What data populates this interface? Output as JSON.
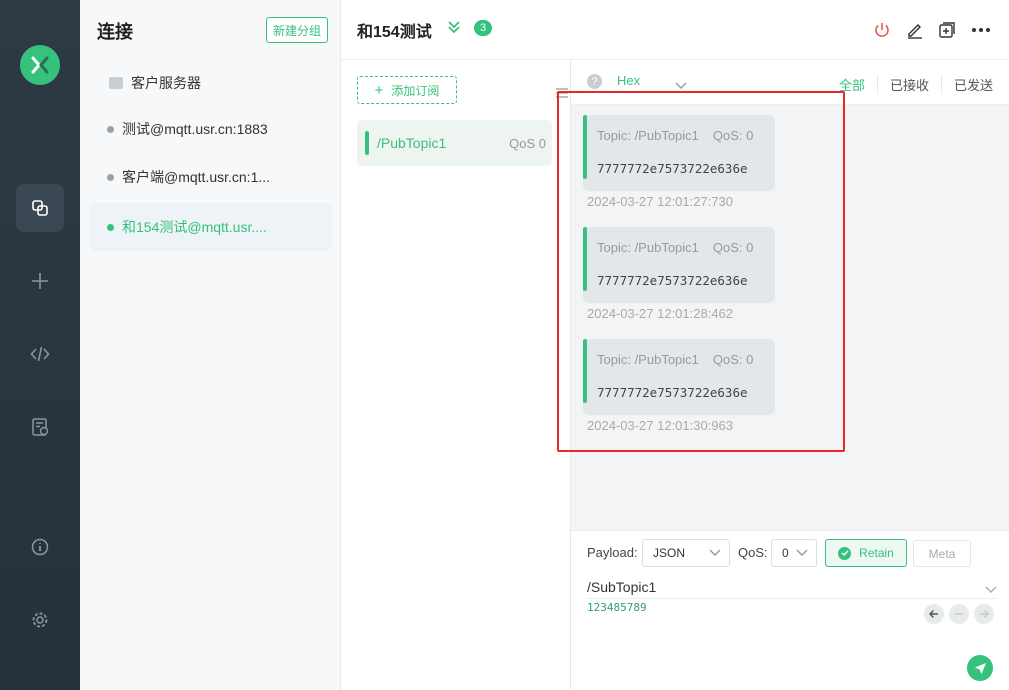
{
  "colors": {
    "accent": "#35c27d",
    "rail_bg": "#2e3a43",
    "highlight": "#e5292a"
  },
  "rail": {
    "logo": "mqttx-logo",
    "items": [
      {
        "icon": "connections-icon",
        "active": true
      },
      {
        "icon": "plus-icon",
        "active": false
      },
      {
        "icon": "code-icon",
        "active": false
      },
      {
        "icon": "log-icon",
        "active": false
      },
      {
        "icon": "info-icon",
        "active": false
      },
      {
        "icon": "gear-icon",
        "active": false
      }
    ]
  },
  "connections": {
    "title": "连接",
    "new_group_label": "新建分组",
    "folder_label": "客户服务器",
    "items": [
      {
        "label": "测试@mqtt.usr.cn:1883",
        "active": false
      },
      {
        "label": "客户端@mqtt.usr.cn:1...",
        "active": false
      },
      {
        "label": "和154测试@mqtt.usr....",
        "active": true
      }
    ]
  },
  "header": {
    "conn_name": "和154测试",
    "count": "3",
    "icons": [
      "power-icon",
      "edit-icon",
      "new-window-icon",
      "more-icon"
    ]
  },
  "subscriptions": {
    "add_label": "添加订阅",
    "items": [
      {
        "topic": "/PubTopic1",
        "qos": "QoS 0"
      }
    ]
  },
  "messages": {
    "format": "Hex",
    "filters": [
      "全部",
      "已接收",
      "已发送"
    ],
    "items": [
      {
        "topic": "Topic: /PubTopic1",
        "qos": "QoS: 0",
        "payload": "7777772e7573722e636e",
        "time": "2024-03-27 12:01:27:730"
      },
      {
        "topic": "Topic: /PubTopic1",
        "qos": "QoS: 0",
        "payload": "7777772e7573722e636e",
        "time": "2024-03-27 12:01:28:462"
      },
      {
        "topic": "Topic: /PubTopic1",
        "qos": "QoS: 0",
        "payload": "7777772e7573722e636e",
        "time": "2024-03-27 12:01:30:963"
      }
    ]
  },
  "composer": {
    "payload_label": "Payload:",
    "payload_format": "JSON",
    "qos_label": "QoS:",
    "qos_value": "0",
    "retain_label": "Retain",
    "meta_label": "Meta",
    "topic": "/SubTopic1",
    "payload": "123485789"
  }
}
